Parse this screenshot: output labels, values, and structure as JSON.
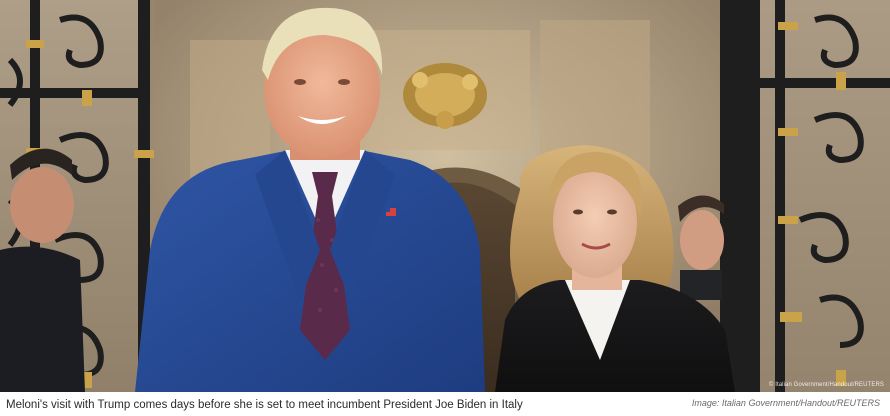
{
  "photo": {
    "alt_subject": "photo",
    "credit_overlay": "© Italian Government/Handout/REUTERS"
  },
  "caption": {
    "text": "Meloni's visit with Trump comes days before she is set to meet incumbent President Joe Biden in Italy",
    "credit": "Image: Italian Government/Handout/REUTERS"
  },
  "colors": {
    "caption_text": "#2b2b2b",
    "credit_text": "#6a6a6a",
    "suit_blue": "#2a4c96",
    "tie_purple": "#5a2a4a",
    "ironwork": "#1e1e1e",
    "gold": "#c9a24a"
  }
}
